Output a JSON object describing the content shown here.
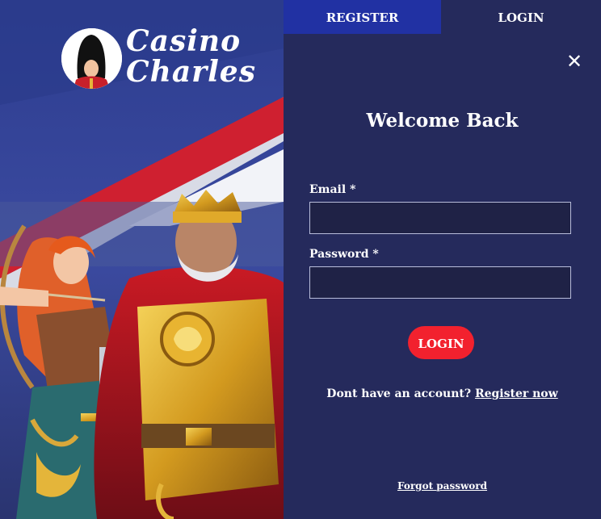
{
  "brand": {
    "logo_line1": "Casino",
    "logo_line2": "Charles"
  },
  "tabs": [
    {
      "label": "REGISTER",
      "active": false
    },
    {
      "label": "LOGIN",
      "active": true
    }
  ],
  "form": {
    "title": "Welcome Back",
    "email_label": "Email *",
    "email_value": "",
    "password_label": "Password *",
    "password_value": "",
    "submit_label": "LOGIN",
    "signup_prompt": "Dont have an account?",
    "signup_link": "Register now",
    "forgot_link": "Forgot password"
  },
  "icons": {
    "close": "close-icon",
    "logo": "guard-icon"
  },
  "colors": {
    "panel_bg": "#252a5c",
    "register_tab_bg": "#2131a3",
    "button_red": "#f2212e",
    "input_bg": "#1f2246"
  }
}
